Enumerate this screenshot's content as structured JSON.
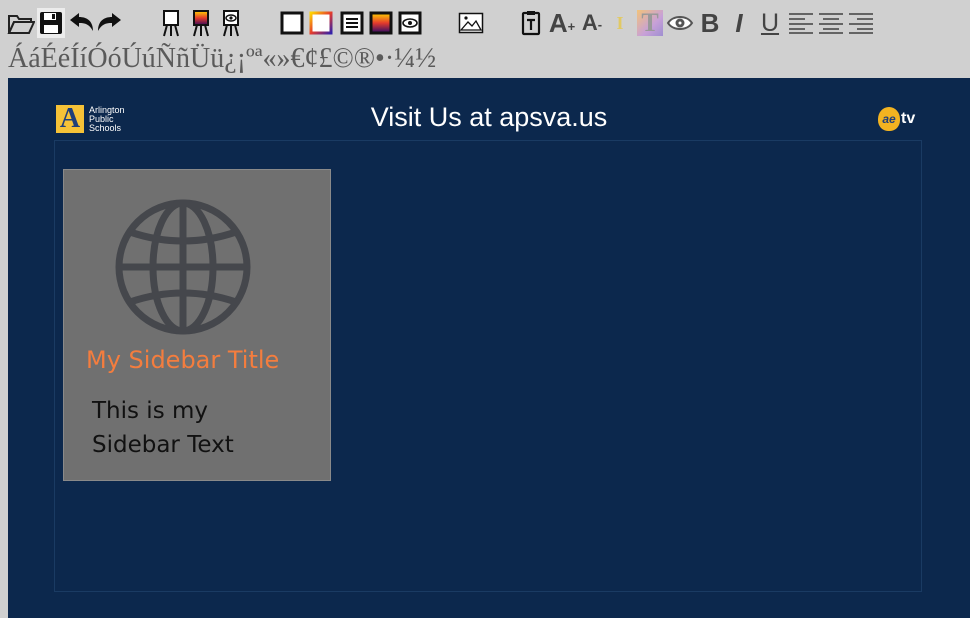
{
  "toolbar": {
    "icons": [
      "open-folder-icon",
      "save-icon",
      "undo-icon",
      "redo-icon",
      "easel-plain-icon",
      "easel-color-icon",
      "easel-image-icon",
      "box-border-icon",
      "box-gradient-border-icon",
      "box-lines-icon",
      "box-fill-icon",
      "box-eye-icon",
      "image-icon",
      "text-box-icon",
      "font-increase-icon",
      "font-decrease-icon",
      "text-color-icon",
      "text-highlight-icon",
      "preview-eye-icon",
      "bold-icon",
      "italic-icon",
      "underline-icon",
      "align-left-icon",
      "align-center-icon",
      "align-right-icon"
    ],
    "font_increase_label": "A",
    "font_increase_sup": "+",
    "font_decrease_label": "A",
    "font_decrease_sup": "-",
    "text_color_label": "I",
    "highlight_label": "T",
    "bold_label": "B",
    "italic_label": "I",
    "underline_label": "U"
  },
  "special_chars": [
    "Á",
    "á",
    "É",
    "é",
    "Í",
    "í",
    "Ó",
    "ó",
    "Ú",
    "ú",
    "Ñ",
    "ñ",
    "Ü",
    "ü",
    "¿",
    "¡",
    "º",
    "ª",
    "«",
    "»",
    "€",
    "¢",
    "£",
    "©",
    "®",
    "•",
    "·",
    "¼",
    "½"
  ],
  "slide": {
    "logo_letter": "A",
    "logo_lines": [
      "Arlington",
      "Public",
      "Schools"
    ],
    "title": "Visit Us at apsva.us",
    "aetv_letters": "ae",
    "aetv_tv": "tv",
    "sidebar": {
      "icon": "globe-icon",
      "title": "My Sidebar Title",
      "text": "This is my Sidebar Text"
    }
  },
  "colors": {
    "slide_bg": "#0c284d",
    "sidebar_bg": "#707070",
    "sidebar_title": "#f47d3e",
    "toolbar_bg": "#d0d0d0"
  }
}
